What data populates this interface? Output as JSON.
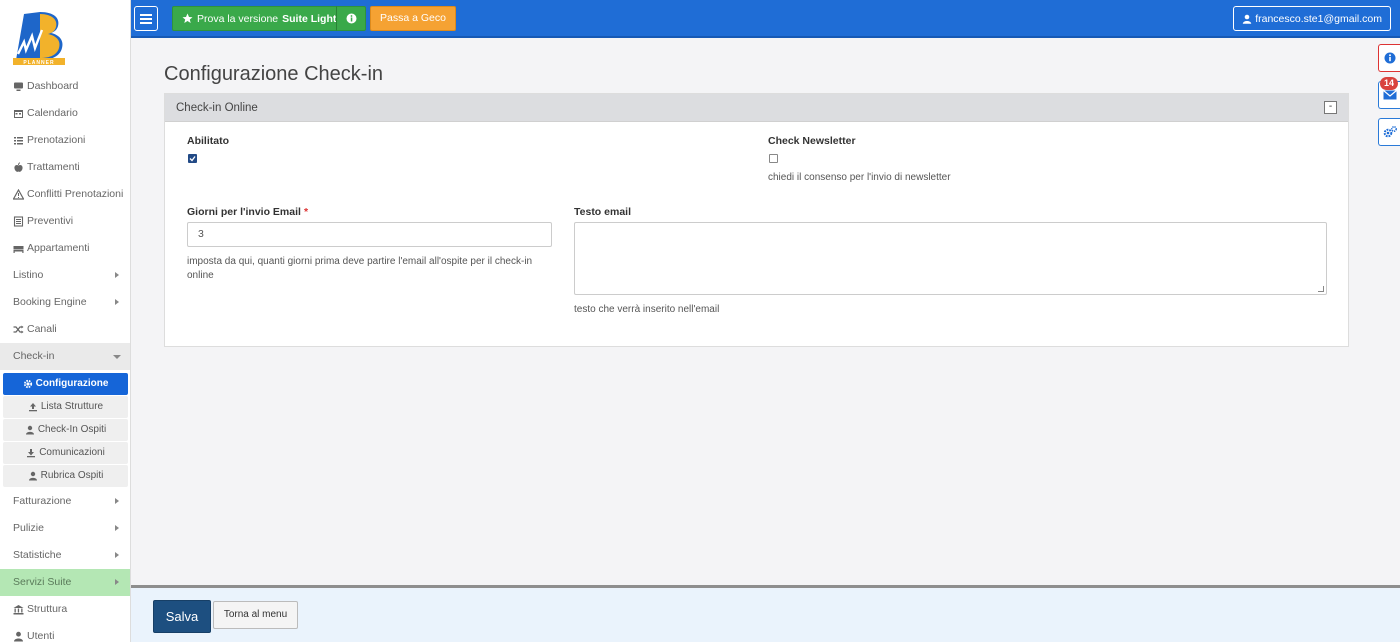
{
  "logo": {
    "brand_text": "PLANNER"
  },
  "sidebar": {
    "items": [
      {
        "label": "Dashboard",
        "icon": "monitor-icon"
      },
      {
        "label": "Calendario",
        "icon": "calendar-icon"
      },
      {
        "label": "Prenotazioni",
        "icon": "list-icon"
      },
      {
        "label": "Trattamenti",
        "icon": "apple-icon"
      },
      {
        "label": "Conflitti Prenotazioni",
        "icon": "warning-icon"
      },
      {
        "label": "Preventivi",
        "icon": "document-icon"
      },
      {
        "label": "Appartamenti",
        "icon": "bed-icon"
      },
      {
        "label": "Listino",
        "has_submenu": true
      },
      {
        "label": "Booking Engine",
        "has_submenu": true
      },
      {
        "label": "Canali",
        "icon": "shuffle-icon"
      },
      {
        "label": "Check-in",
        "has_submenu": true,
        "open": true
      }
    ],
    "checkin_sub": [
      {
        "label": "Configurazione",
        "icon": "gear-icon",
        "active": true
      },
      {
        "label": "Lista Strutture",
        "icon": "upload-icon"
      },
      {
        "label": "Check-In Ospiti",
        "icon": "user-icon"
      },
      {
        "label": "Comunicazioni",
        "icon": "download-icon"
      },
      {
        "label": "Rubrica Ospiti",
        "icon": "user-icon"
      }
    ],
    "items_after": [
      {
        "label": "Fatturazione",
        "has_submenu": true
      },
      {
        "label": "Pulizie",
        "has_submenu": true
      },
      {
        "label": "Statistiche",
        "has_submenu": true
      },
      {
        "label": "Servizi Suite",
        "has_submenu": true,
        "highlight": true
      },
      {
        "label": "Struttura",
        "icon": "building-icon"
      },
      {
        "label": "Utenti",
        "icon": "user-icon"
      }
    ]
  },
  "topbar": {
    "suite_prefix": "Prova la versione",
    "suite_bold": "Suite Light",
    "geco_label": "Passa a Geco",
    "user_email": "francesco.ste1@gmail.com"
  },
  "floats": {
    "mail_badge": "14"
  },
  "page": {
    "title": "Configurazione Check-in"
  },
  "panel": {
    "title": "Check-in Online",
    "collapse_label": "-",
    "enabled_label": "Abilitato",
    "enabled_checked": true,
    "newsletter_label": "Check Newsletter",
    "newsletter_checked": false,
    "newsletter_help": "chiedi il consenso per l'invio di newsletter",
    "days_label": "Giorni per l'invio Email",
    "required_mark": "*",
    "days_value": "3",
    "days_help": "imposta da qui, quanti giorni prima deve partire l'email all'ospite per il check-in online",
    "email_text_label": "Testo email",
    "email_text_value": "",
    "email_text_help": "testo che verrà inserito nell'email"
  },
  "footer": {
    "save_label": "Salva",
    "back_label": "Torna al menu"
  },
  "colors": {
    "primary": "#1f6dd6",
    "suite_green": "#3aa94a",
    "geco_orange": "#f5a233",
    "save_navy": "#1d4f80"
  }
}
